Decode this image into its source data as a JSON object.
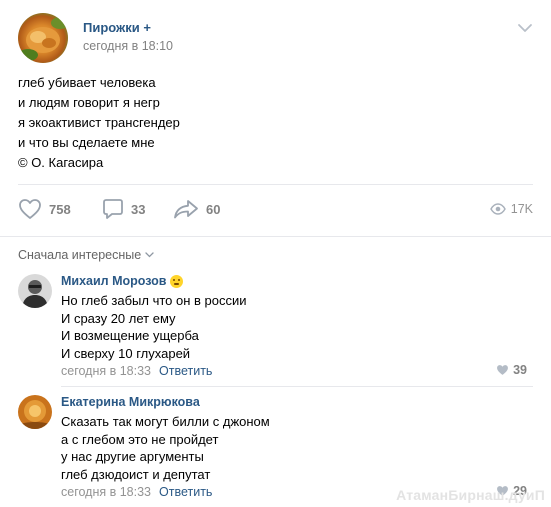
{
  "post": {
    "group_name": "Пирожки +",
    "date": "сегодня в 18:10",
    "text_lines": [
      "глеб убивает человека",
      "и людям говорит я негр",
      "я экоактивист трансгендер",
      "и что вы сделаете мне",
      "© О. Кагасира"
    ]
  },
  "actions": {
    "likes": "758",
    "comments": "33",
    "shares": "60",
    "views": "17K"
  },
  "comments_sort": "Сначала интересные",
  "comments": [
    {
      "author": "Михаил Морозов",
      "lines": [
        "Но глеб забыл что он в россии",
        "И сразу 20 лет ему",
        "И возмещение ущерба",
        "И сверху 10 глухарей"
      ],
      "date": "сегодня в 18:33",
      "reply": "Ответить",
      "likes": "39"
    },
    {
      "author": "Екатерина Микрюкова",
      "lines": [
        "Сказать так могут билли с джоном",
        "а с глебом это не пройдет",
        "у нас другие аргументы",
        "глеб дзюдоист и депутат"
      ],
      "date": "сегодня в 18:33",
      "reply": "Ответить",
      "likes": "29"
    }
  ],
  "watermark": "АтаманБирнаш.дуиП",
  "colors": {
    "link": "#2a5885",
    "secondary": "#828282",
    "divider": "#e7e8ec"
  }
}
